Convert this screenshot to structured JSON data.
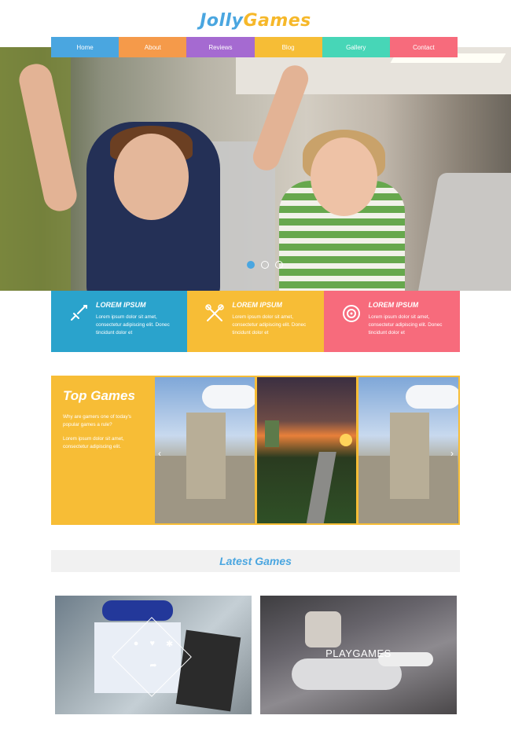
{
  "brand": {
    "part1": "Jolly",
    "part2": "Games"
  },
  "nav": {
    "items": [
      {
        "label": "Home",
        "color": "#4aa6e0"
      },
      {
        "label": "About",
        "color": "#f59a4a"
      },
      {
        "label": "Reviews",
        "color": "#a56ad1"
      },
      {
        "label": "Blog",
        "color": "#f6bd36"
      },
      {
        "label": "Gallery",
        "color": "#47d6b7"
      },
      {
        "label": "Contact",
        "color": "#f76b7c"
      }
    ]
  },
  "slider": {
    "dot_count": 3,
    "active_index": 0
  },
  "features": [
    {
      "icon": "sword-icon",
      "title": "LOREM IPSUM",
      "text": "Lorem ipsum dolor sit amet, consectetur adipiscing elit. Donec tincidunt dolor et",
      "color": "#2aa3cc"
    },
    {
      "icon": "crossed-tools-icon",
      "title": "LOREM IPSUM",
      "text": "Lorem ipsum dolor sit amet, consectetur adipiscing elit. Donec tincidunt dolor et",
      "color": "#f7bd36"
    },
    {
      "icon": "target-icon",
      "title": "LOREM IPSUM",
      "text": "Lorem ipsum dolor sit amet, consectetur adipiscing elit. Donec tincidunt dolor et",
      "color": "#f76b7c"
    }
  ],
  "top_games": {
    "title": "Top Games",
    "text1": "Why are gamers one of today's popular games a rule?",
    "text2": "Lorem ipsum dolor sit amet, consectetur adipiscing elit."
  },
  "latest_games": {
    "title": "Latest Games",
    "card2_label": "PLAYGAMES"
  },
  "colors": {
    "accent_blue": "#4aa6e0",
    "accent_yellow": "#f6b82a"
  }
}
